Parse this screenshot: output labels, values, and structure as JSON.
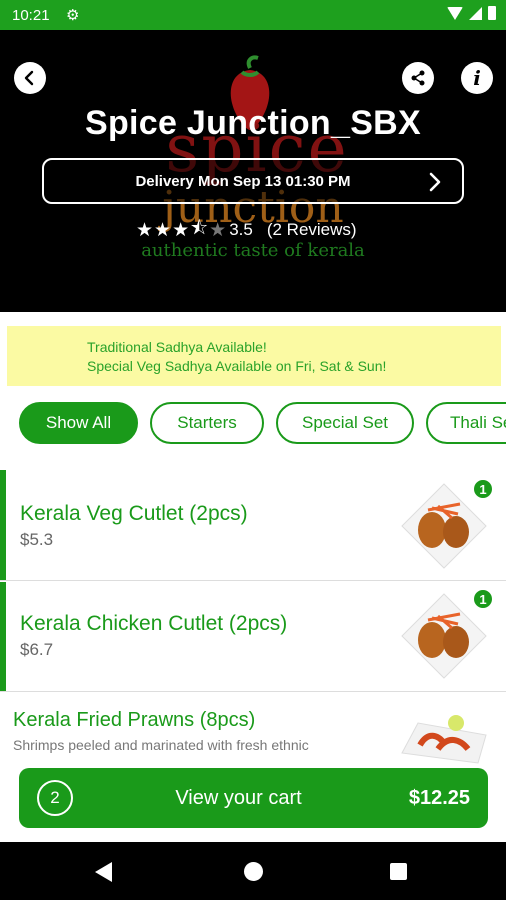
{
  "status_bar": {
    "time": "10:21"
  },
  "restaurant": {
    "name": "Spice Junction_SBX",
    "logo": {
      "word1": "spice",
      "word2": "junction",
      "tagline": "authentic taste of kerala"
    },
    "delivery_label": "Delivery Mon Sep 13 01:30 PM",
    "rating_value": "3.5",
    "rating_stars": 3.5,
    "reviews_label": "(2 Reviews)"
  },
  "announcement": {
    "line1": "Traditional Sadhya Available!",
    "line2": "Special Veg Sadhya Available on Fri, Sat & Sun!"
  },
  "categories": [
    "Show All",
    "Starters",
    "Special Set",
    "Thali Se"
  ],
  "menu_items": [
    {
      "name": "Kerala Veg Cutlet (2pcs)",
      "price": "$5.3",
      "qty": "1"
    },
    {
      "name": "Kerala Chicken Cutlet (2pcs)",
      "price": "$6.7",
      "qty": "1"
    },
    {
      "name": "Kerala Fried Prawns (8pcs)",
      "description": "Shrimps peeled and marinated with fresh ethnic"
    }
  ],
  "cart": {
    "count": "2",
    "label": "View your cart",
    "total": "$12.25"
  },
  "colors": {
    "brand_green": "#1a9a1a",
    "status_green": "#1ea01e",
    "banner_yellow": "#fbfaa3"
  },
  "icons": [
    "back-icon",
    "share-icon",
    "info-icon",
    "chevron-right-icon",
    "star-icon"
  ]
}
